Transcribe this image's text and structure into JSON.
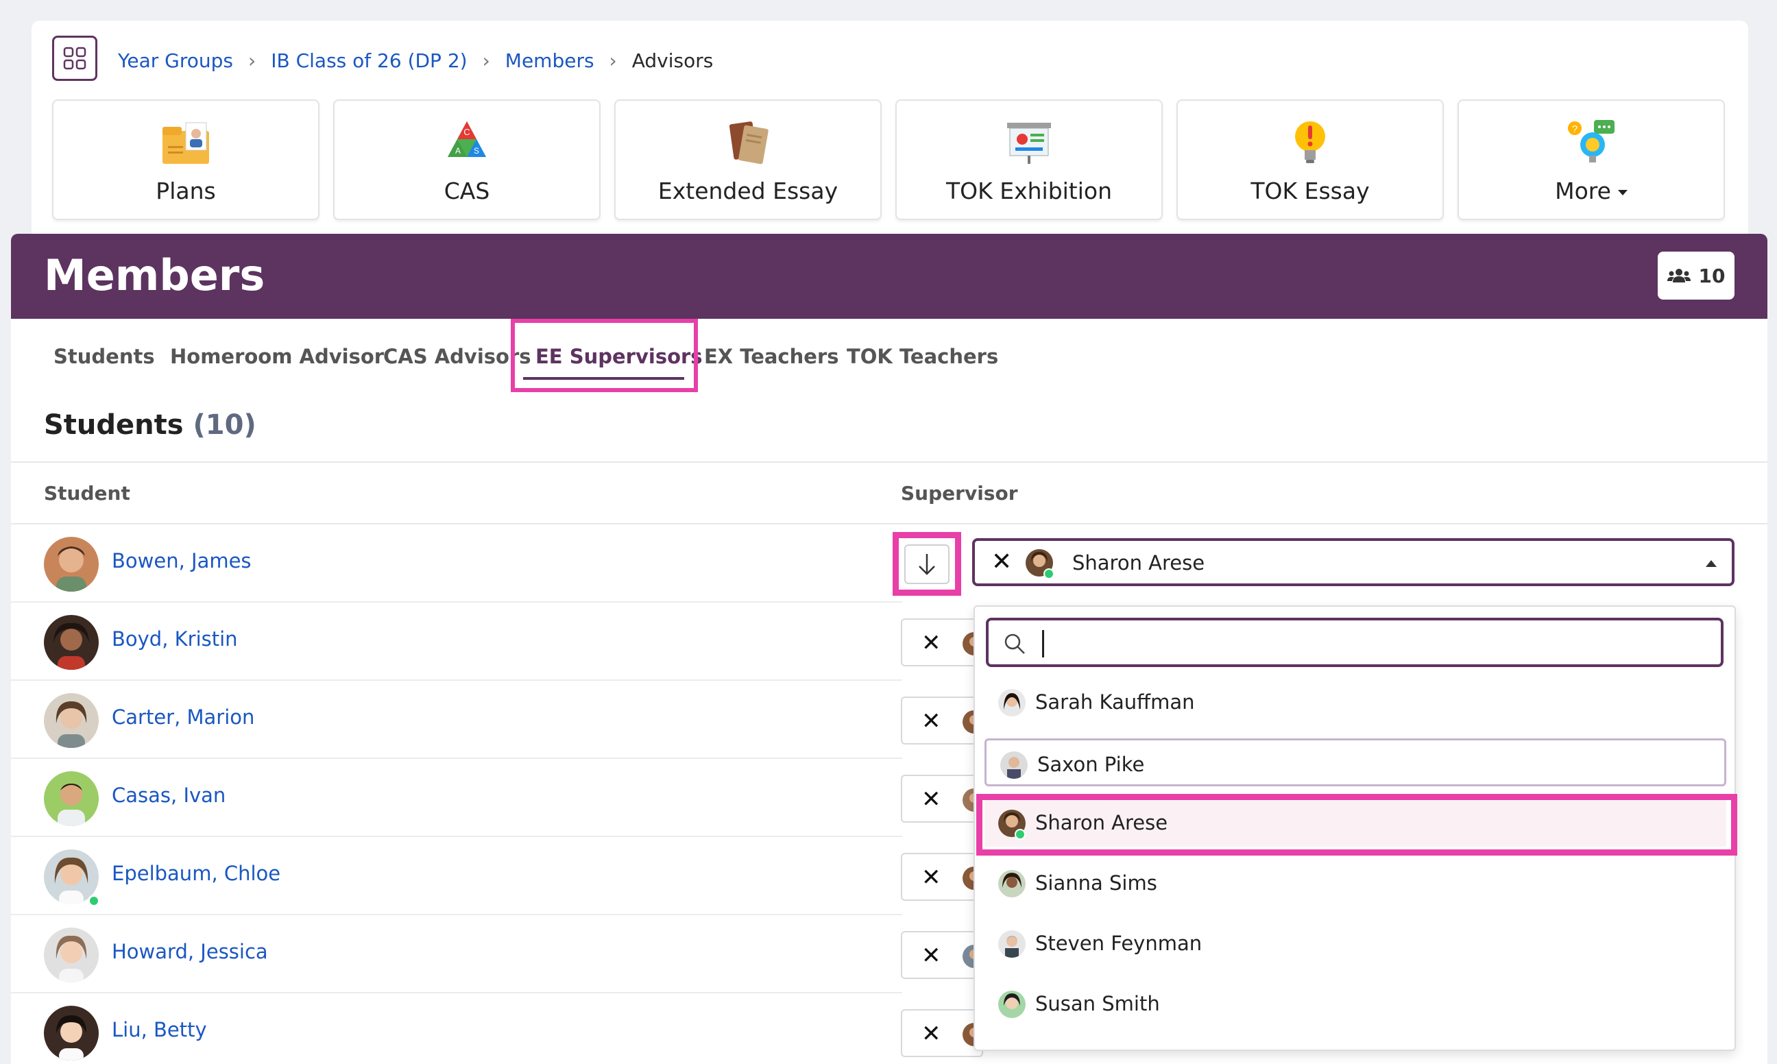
{
  "breadcrumb": {
    "items": [
      "Year Groups",
      "IB Class of 26 (DP 2)",
      "Members"
    ],
    "current": "Advisors"
  },
  "tiles": [
    {
      "label": "Plans",
      "icon": "folder-person-icon"
    },
    {
      "label": "CAS",
      "icon": "cas-triangle-icon"
    },
    {
      "label": "Extended Essay",
      "icon": "books-icon"
    },
    {
      "label": "TOK Exhibition",
      "icon": "presentation-board-icon"
    },
    {
      "label": "TOK Essay",
      "icon": "lightbulb-exclamation-icon"
    },
    {
      "label": "More",
      "icon": "question-bubble-icon"
    }
  ],
  "panel": {
    "title": "Members",
    "member_count": "10"
  },
  "tabs": [
    {
      "label": "Students",
      "active": false
    },
    {
      "label": "Homeroom Advisor",
      "active": false
    },
    {
      "label": "CAS Advisors",
      "active": false
    },
    {
      "label": "EE Supervisors",
      "active": true
    },
    {
      "label": "EX Teachers",
      "active": false
    },
    {
      "label": "TOK Teachers",
      "active": false
    }
  ],
  "section": {
    "title": "Students",
    "count": "(10)"
  },
  "columns": {
    "student": "Student",
    "supervisor": "Supervisor"
  },
  "students": [
    {
      "name": "Bowen, James",
      "online": false
    },
    {
      "name": "Boyd, Kristin",
      "online": false
    },
    {
      "name": "Carter, Marion",
      "online": false
    },
    {
      "name": "Casas, Ivan",
      "online": false
    },
    {
      "name": "Epelbaum, Chloe",
      "online": true
    },
    {
      "name": "Howard, Jessica",
      "online": false
    },
    {
      "name": "Liu, Betty",
      "online": false
    }
  ],
  "supervisor_select": {
    "selected": "Sharon Arese",
    "search_value": ""
  },
  "dropdown_options": [
    {
      "name": "Sarah Kauffman",
      "state": "normal"
    },
    {
      "name": "Saxon Pike",
      "state": "hover"
    },
    {
      "name": "Sharon Arese",
      "state": "selected"
    },
    {
      "name": "Sianna Sims",
      "state": "normal"
    },
    {
      "name": "Steven Feynman",
      "state": "normal"
    },
    {
      "name": "Susan Smith",
      "state": "normal"
    }
  ],
  "colors": {
    "brand_purple": "#5d3360",
    "link_blue": "#1a57c2",
    "highlight_pink": "#e83fa8",
    "online_green": "#2ecc71"
  }
}
